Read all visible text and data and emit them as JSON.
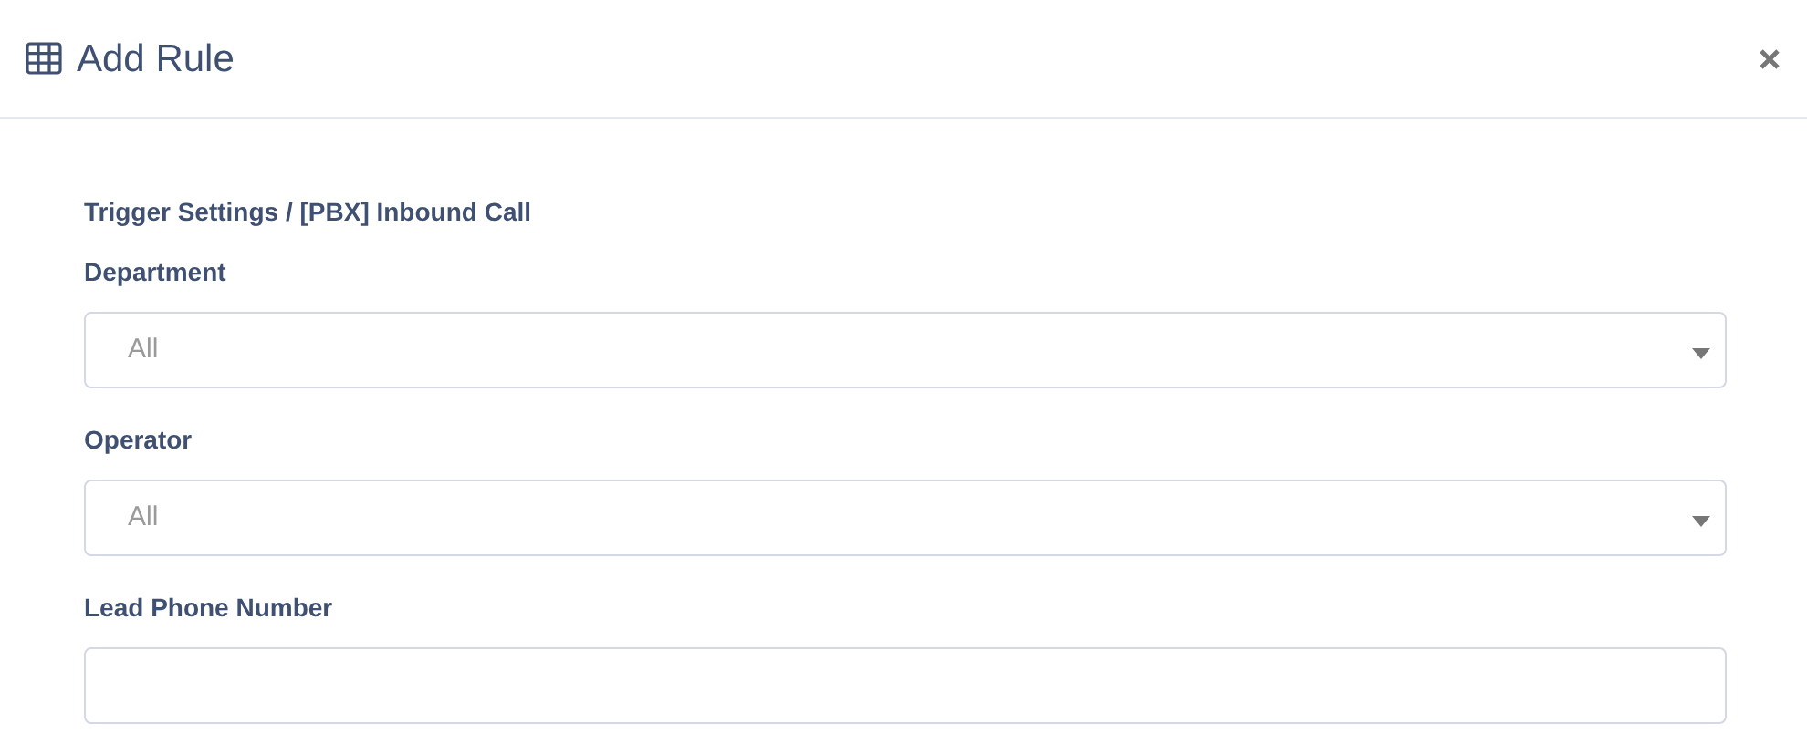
{
  "dialog": {
    "title": "Add Rule"
  },
  "section_title": "Trigger Settings / [PBX] Inbound Call",
  "fields": [
    {
      "kind": "select",
      "label": "Department",
      "value": "All"
    },
    {
      "kind": "select",
      "label": "Operator",
      "value": "All"
    },
    {
      "kind": "text",
      "label": "Lead Phone Number"
    }
  ]
}
